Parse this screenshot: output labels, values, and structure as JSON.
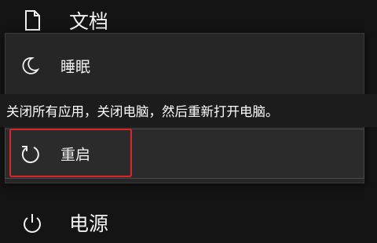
{
  "start_menu": {
    "documents": {
      "label": "文档",
      "icon": "document-icon"
    },
    "power": {
      "label": "电源",
      "icon": "power-icon"
    }
  },
  "power_menu": {
    "items": [
      {
        "label": "睡眠",
        "icon": "moon-icon"
      },
      {
        "label": "重启",
        "icon": "restart-icon"
      }
    ],
    "tooltip": "关闭所有应用，关闭电脑，然后重新打开电脑。"
  },
  "colors": {
    "background": "#141414",
    "menu_background": "#262626",
    "highlight_border": "#e0242b",
    "text": "#ffffff"
  }
}
